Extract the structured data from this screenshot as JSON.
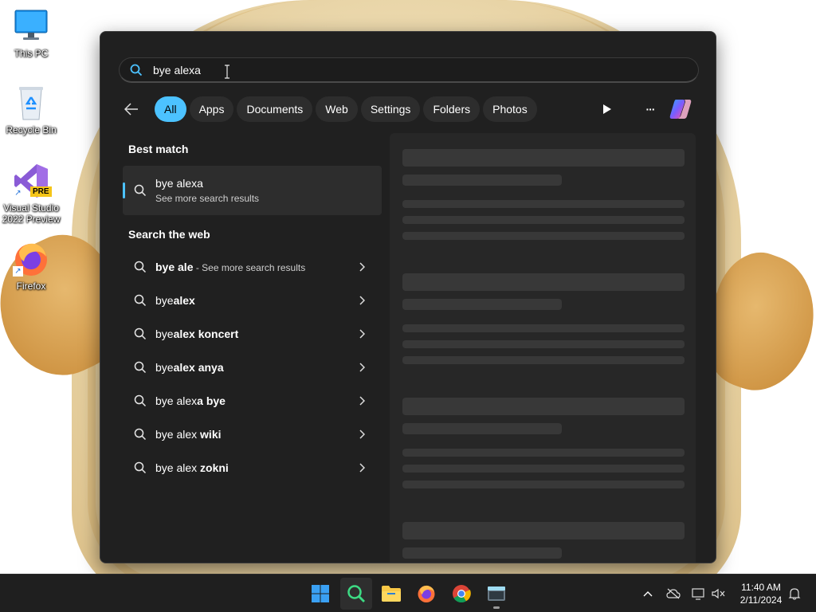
{
  "desktop": {
    "icons": [
      {
        "label": "This PC",
        "icon": "monitor-icon"
      },
      {
        "label": "Recycle Bin",
        "icon": "recycle-bin-icon"
      },
      {
        "label": "Visual Studio 2022 Preview",
        "icon": "visual-studio-icon",
        "badge": "PRE"
      },
      {
        "label": "Firefox",
        "icon": "firefox-icon"
      }
    ]
  },
  "search": {
    "query": "bye alexa",
    "placeholder": ""
  },
  "filters": {
    "chips": [
      "All",
      "Apps",
      "Documents",
      "Web",
      "Settings",
      "Folders",
      "Photos"
    ],
    "active": "All",
    "more_label": "···"
  },
  "best_match": {
    "heading": "Best match",
    "title": "bye alexa",
    "subtitle": "See more search results"
  },
  "web": {
    "heading": "Search the web",
    "results": [
      {
        "prefix": "bye ale",
        "bold": "",
        "hint": " - See more search results"
      },
      {
        "prefix": "bye",
        "bold": "alex",
        "hint": ""
      },
      {
        "prefix": "bye",
        "bold": "alex koncert",
        "hint": ""
      },
      {
        "prefix": "bye",
        "bold": "alex anya",
        "hint": ""
      },
      {
        "prefix": "bye alex",
        "bold": "a bye",
        "hint": ""
      },
      {
        "prefix": "bye alex ",
        "bold": "wiki",
        "hint": ""
      },
      {
        "prefix": "bye alex ",
        "bold": "zokni",
        "hint": ""
      }
    ]
  },
  "taskbar": {
    "apps": [
      "start-icon",
      "search-icon",
      "file-explorer-icon",
      "firefox-icon",
      "chrome-icon",
      "terminal-icon"
    ],
    "time": "11:40 AM",
    "date": "2/11/2024"
  },
  "colors": {
    "accent": "#4cc2ff",
    "panel": "#202020",
    "taskbar": "#1f1f1f"
  }
}
